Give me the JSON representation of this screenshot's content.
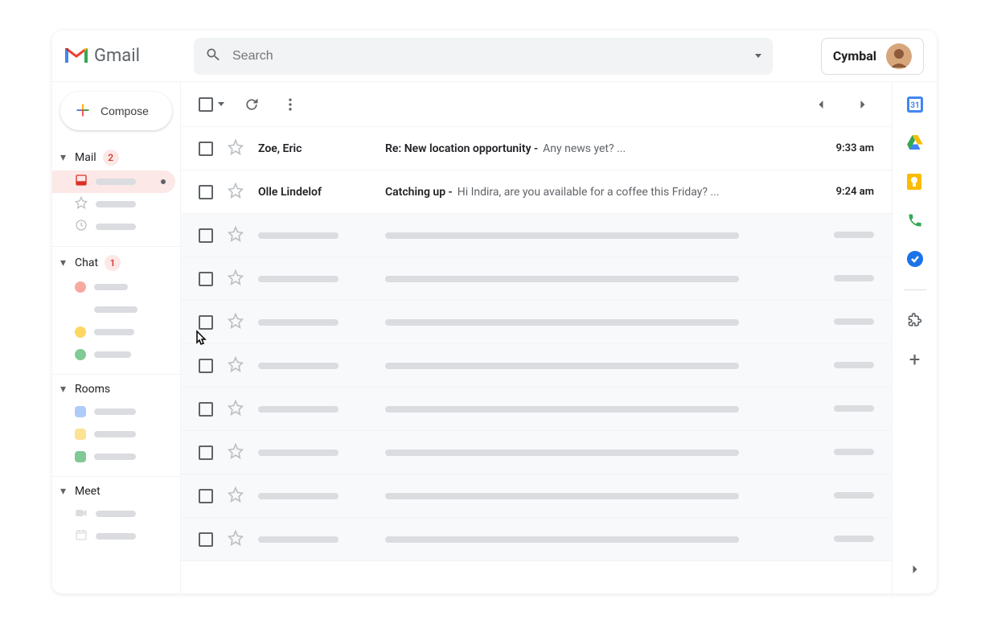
{
  "header": {
    "app_name": "Gmail",
    "search_placeholder": "Search",
    "org_label": "Cymbal"
  },
  "compose": {
    "label": "Compose"
  },
  "sidebar": {
    "mail": {
      "label": "Mail",
      "badge": "2"
    },
    "chat": {
      "label": "Chat",
      "badge": "1"
    },
    "rooms": {
      "label": "Rooms"
    },
    "meet": {
      "label": "Meet"
    }
  },
  "emails": [
    {
      "sender": "Zoe, Eric",
      "subject": "Re: New location opportunity -",
      "preview": "Any news yet? ...",
      "time": "9:33 am"
    },
    {
      "sender": "Olle Lindelof",
      "subject": "Catching up -",
      "preview": "Hi Indira, are you available for a coffee this Friday? ...",
      "time": "9:24 am"
    }
  ],
  "rail": {
    "calendar_day": "31"
  }
}
